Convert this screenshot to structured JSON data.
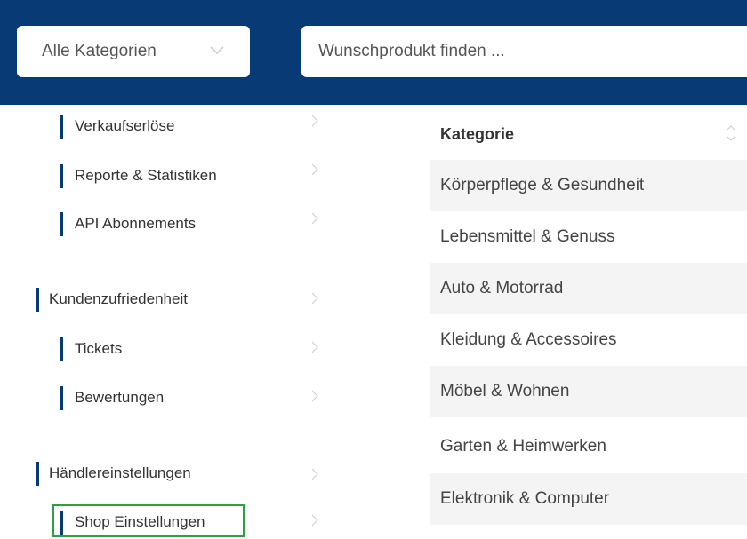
{
  "header": {
    "category_select": "Alle Kategorien",
    "search_placeholder": "Wunschprodukt finden ..."
  },
  "sidebar": {
    "items": [
      {
        "label": "Verkaufserlöse"
      },
      {
        "label": "Reporte & Statistiken"
      },
      {
        "label": "API Abonnements"
      },
      {
        "label": "Kundenzufriedenheit"
      },
      {
        "label": "Tickets"
      },
      {
        "label": "Bewertungen"
      },
      {
        "label": "Händlereinstellungen"
      },
      {
        "label": "Shop Einstellungen"
      }
    ]
  },
  "categories": {
    "header": "Kategorie",
    "rows": [
      "Körperpflege & Gesundheit",
      "Lebensmittel & Genuss",
      "Auto & Motorrad",
      "Kleidung & Accessoires",
      "Möbel & Wohnen",
      "Garten & Heimwerken",
      "Elektronik & Computer"
    ]
  },
  "colors": {
    "header_bg": "#083a76",
    "accent_bar": "#083a76",
    "highlight_border": "#2ea043",
    "row_shade": "#f4f4f4"
  }
}
